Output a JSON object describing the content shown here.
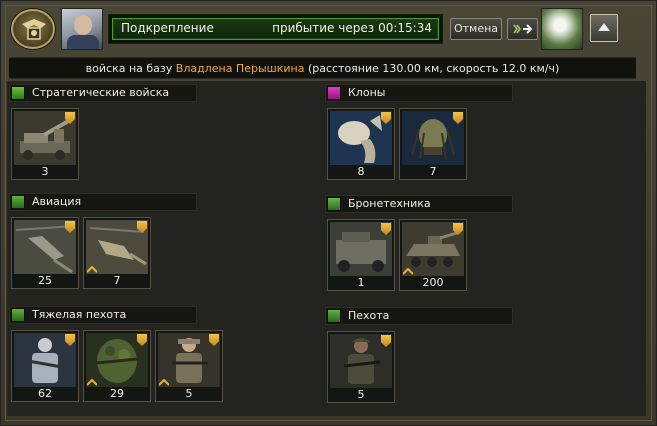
{
  "header": {
    "emblem_icon": "faction-emblem-icon",
    "avatar_icon": "player-avatar",
    "status": {
      "label": "Подкрепление",
      "eta_label": "прибытие через",
      "eta_time": "00:15:34",
      "progress_percent": 100
    },
    "cancel_label": "Отмена",
    "go_icon": "send-arrow-icon",
    "target_avatar_icon": "target-avatar",
    "collapse_icon": "collapse-up-icon"
  },
  "info": {
    "prefix": "войска на базу",
    "player_name": "Владлена Перышкина",
    "details": "(расстояние 130.00 км, скорость 12.0 км/ч)"
  },
  "colors": {
    "accent_name": "#f0a93a",
    "progress_border": "#4a9a2e",
    "rank_shield": "#e8b43a"
  },
  "groups": [
    {
      "title": "Стратегические войска",
      "icon": "strategic-icon",
      "units": [
        {
          "count": "3",
          "art": "artillery"
        }
      ]
    },
    {
      "title": "Клоны",
      "icon": "clones-icon",
      "units": [
        {
          "count": "8",
          "art": "alien"
        },
        {
          "count": "7",
          "art": "predator"
        }
      ]
    },
    {
      "title": "Авиация",
      "icon": "aviation-icon",
      "units": [
        {
          "count": "25",
          "art": "helicopter"
        },
        {
          "count": "7",
          "art": "helicopter-2"
        }
      ]
    },
    {
      "title": "Бронетехника",
      "icon": "armor-icon",
      "units": [
        {
          "count": "1",
          "art": "humvee"
        },
        {
          "count": "200",
          "art": "apc"
        }
      ]
    },
    {
      "title": "Тяжелая пехота",
      "icon": "heavy-infantry-icon",
      "units": [
        {
          "count": "62",
          "art": "winter-soldier"
        },
        {
          "count": "29",
          "art": "ghillie-soldier"
        },
        {
          "count": "5",
          "art": "desert-soldier"
        }
      ]
    },
    {
      "title": "Пехота",
      "icon": "infantry-icon",
      "units": [
        {
          "count": "5",
          "art": "soldier"
        }
      ]
    }
  ]
}
